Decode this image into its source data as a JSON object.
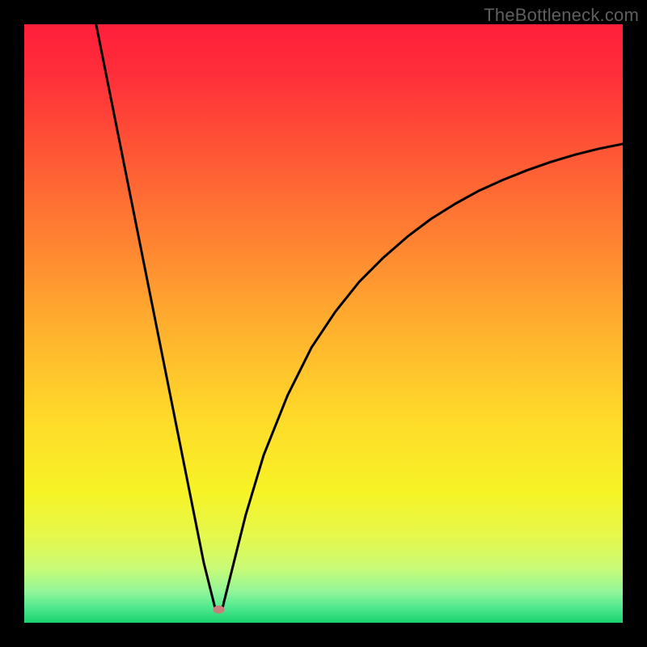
{
  "watermark": "TheBottleneck.com",
  "chart_data": {
    "type": "line",
    "title": "",
    "xlabel": "",
    "ylabel": "",
    "xlim": [
      0,
      100
    ],
    "ylim": [
      0,
      100
    ],
    "notch_x": 32,
    "notch_marker": {
      "x": 32.5,
      "y": 2.2,
      "color": "#c97f7b"
    },
    "series": [
      {
        "name": "bottleneck-curve",
        "x": [
          12,
          14,
          16,
          18,
          20,
          22,
          24,
          26,
          28,
          30,
          31,
          31.5,
          32,
          32.5,
          33,
          33.5,
          34,
          35,
          37,
          40,
          44,
          48,
          52,
          56,
          60,
          64,
          68,
          72,
          76,
          80,
          84,
          88,
          92,
          96,
          100
        ],
        "y": [
          100,
          90,
          80,
          70,
          60,
          50,
          40,
          30,
          20,
          10,
          6,
          4,
          2,
          2,
          2,
          4,
          6,
          10,
          18,
          28,
          38,
          46,
          52,
          57,
          61,
          64.5,
          67.5,
          70,
          72.2,
          74,
          75.6,
          77,
          78.2,
          79.2,
          80
        ]
      }
    ],
    "gradient_stops": [
      {
        "offset": 0.0,
        "color": "#ff1f3a"
      },
      {
        "offset": 0.08,
        "color": "#ff2d3a"
      },
      {
        "offset": 0.2,
        "color": "#ff5236"
      },
      {
        "offset": 0.35,
        "color": "#ff7f32"
      },
      {
        "offset": 0.5,
        "color": "#ffae2e"
      },
      {
        "offset": 0.65,
        "color": "#ffd82a"
      },
      {
        "offset": 0.78,
        "color": "#f7f326"
      },
      {
        "offset": 0.86,
        "color": "#e4f84e"
      },
      {
        "offset": 0.91,
        "color": "#c8fb78"
      },
      {
        "offset": 0.95,
        "color": "#8ef59a"
      },
      {
        "offset": 0.975,
        "color": "#4fe88e"
      },
      {
        "offset": 1.0,
        "color": "#18d36e"
      }
    ]
  }
}
